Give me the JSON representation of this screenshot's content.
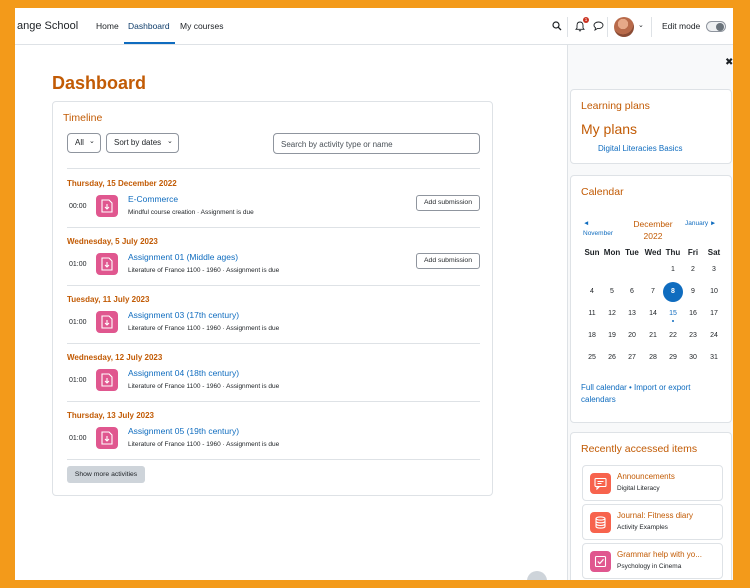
{
  "navbar": {
    "brand": "ange School",
    "links": [
      {
        "label": "Home"
      },
      {
        "label": "Dashboard"
      },
      {
        "label": "My courses"
      }
    ],
    "notification_count": "1",
    "edit_mode_label": "Edit mode",
    "edit_mode_on": false
  },
  "page": {
    "title": "Dashboard"
  },
  "timeline": {
    "title": "Timeline",
    "filter_label": "All",
    "sort_label": "Sort by dates",
    "search_placeholder": "Search by activity type or name",
    "groups": [
      {
        "date": "Thursday, 15 December 2022",
        "time": "00:00",
        "name": "E-Commerce",
        "sub": "Mindful course creation · Assignment is due",
        "action": "Add submission"
      },
      {
        "date": "Wednesday, 5 July 2023",
        "time": "01:00",
        "name": "Assignment 01 (Middle ages)",
        "sub": "Literature of France 1100 - 1960 · Assignment is due",
        "action": "Add submission"
      },
      {
        "date": "Tuesday, 11 July 2023",
        "time": "01:00",
        "name": "Assignment 03 (17th century)",
        "sub": "Literature of France 1100 - 1960 · Assignment is due",
        "action": ""
      },
      {
        "date": "Wednesday, 12 July 2023",
        "time": "01:00",
        "name": "Assignment 04 (18th century)",
        "sub": "Literature of France 1100 - 1960 · Assignment is due",
        "action": ""
      },
      {
        "date": "Thursday, 13 July 2023",
        "time": "01:00",
        "name": "Assignment 05 (19th century)",
        "sub": "Literature of France 1100 - 1960 · Assignment is due",
        "action": ""
      }
    ],
    "show_more_label": "Show more activities"
  },
  "learning_plans": {
    "title": "Learning plans",
    "heading": "My plans",
    "plan": "Digital Literacies Basics"
  },
  "calendar": {
    "title": "Calendar",
    "prev_label": "◄",
    "prev_month": "November",
    "month": "December",
    "year": "2022",
    "next_label": "January ►",
    "weekdays": [
      "Sun",
      "Mon",
      "Tue",
      "Wed",
      "Thu",
      "Fri",
      "Sat"
    ],
    "weeks": [
      [
        "",
        "",
        "",
        "",
        "1",
        "2",
        "3"
      ],
      [
        "4",
        "5",
        "6",
        "7",
        "8",
        "9",
        "10"
      ],
      [
        "11",
        "12",
        "13",
        "14",
        "15",
        "16",
        "17"
      ],
      [
        "18",
        "19",
        "20",
        "21",
        "22",
        "23",
        "24"
      ],
      [
        "25",
        "26",
        "27",
        "28",
        "29",
        "30",
        "31"
      ]
    ],
    "today": "8",
    "event_days": [
      "15"
    ],
    "footer_links": "Full calendar • Import or export calendars"
  },
  "recent": {
    "title": "Recently accessed items",
    "items": [
      {
        "name": "Announcements",
        "sub": "Digital Literacy",
        "icon": "forum-icon",
        "color": "#f7634d"
      },
      {
        "name": "Journal: Fitness diary",
        "sub": "Activity Examples",
        "icon": "database-icon",
        "color": "#f7634d"
      },
      {
        "name": "Grammar help with yo...",
        "sub": "Psychology in Cinema",
        "icon": "checkbox-icon",
        "color": "#e0578f"
      }
    ]
  },
  "colors": {
    "accent": "#c25b05",
    "link": "#0f6cbf",
    "assignment_icon": "#e0578f",
    "frame": "#f39a1a"
  }
}
